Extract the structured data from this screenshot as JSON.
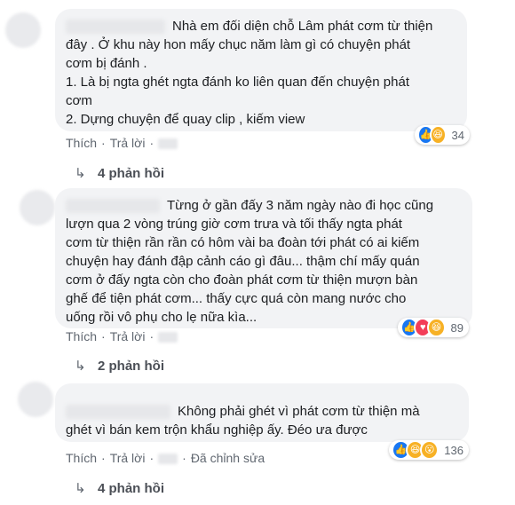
{
  "comments": [
    {
      "lines": [
        "Nhà em đối diện chỗ Lâm phát cơm từ thiện",
        "đây . Ở khu này hon mấy chục năm làm gì có chuyện phát",
        "cơm bị đánh .",
        "1. Là bị ngta ghét ngta đánh ko liên quan đến chuyện phát",
        "cơm",
        "2. Dựng chuyện để quay clip , kiếm view"
      ],
      "actions": {
        "like": "Thích",
        "reply": "Trả lời",
        "edited": ""
      },
      "reaction_count": "34",
      "reactions": [
        "like-icon",
        "haha-icon"
      ],
      "replies": "4 phản hồi"
    },
    {
      "lines": [
        "Từng ở gần đấy 3 năm ngày nào đi học cũng",
        "lượn qua 2 vòng trúng giờ cơm trưa và tối thấy ngta phát",
        "cơm từ thiện rần rần có hôm vài ba đoàn tới phát có ai kiếm",
        "chuyện hay đánh đập cảnh cáo gì đâu... thậm chí mấy quán",
        "cơm ở đấy ngta còn cho đoàn phát cơm từ thiện mượn bàn",
        "ghế để tiện phát cơm... thấy cực quá còn mang nước cho",
        "uống rồi vô phụ cho lẹ nữa kìa..."
      ],
      "actions": {
        "like": "Thích",
        "reply": "Trả lời",
        "edited": ""
      },
      "reaction_count": "89",
      "reactions": [
        "like-icon",
        "heart-icon",
        "haha-icon"
      ],
      "replies": "2 phản hồi"
    },
    {
      "lines": [
        "Không phải ghét vì phát cơm từ thiện mà",
        "ghét vì bán kem trộn khẩu nghiệp ấy. Đéo ưa được"
      ],
      "actions": {
        "like": "Thích",
        "reply": "Trả lời",
        "edited": "Đã chỉnh sửa"
      },
      "reaction_count": "136",
      "reactions": [
        "like-icon",
        "haha-icon",
        "wow-icon"
      ],
      "replies": "4 phản hồi"
    }
  ],
  "colors": {
    "like": "#1877f2",
    "heart": "#f33e58",
    "haha": "#f7b125"
  }
}
